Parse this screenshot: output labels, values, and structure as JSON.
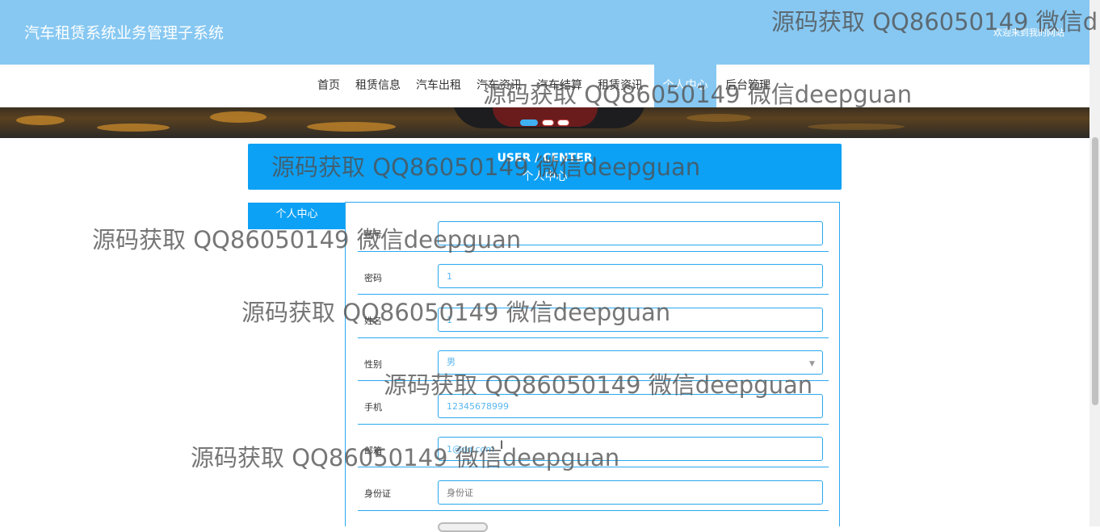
{
  "header": {
    "title": "汽车租赁系统业务管理子系统",
    "welcome": "欢迎来到我的网站"
  },
  "nav": {
    "items": [
      {
        "label": "首页"
      },
      {
        "label": "租赁信息"
      },
      {
        "label": "汽车出租"
      },
      {
        "label": "汽车资讯"
      },
      {
        "label": "汽车结算"
      },
      {
        "label": "租赁资讯"
      },
      {
        "label": "个人中心"
      },
      {
        "label": "后台管理"
      }
    ],
    "active": "个人中心"
  },
  "panel": {
    "title_en": "USER / CENTER",
    "title_cn": "个人中心"
  },
  "sidebar": {
    "items": [
      {
        "label": "个人中心"
      }
    ]
  },
  "form": {
    "username": {
      "label": "账号",
      "value": ""
    },
    "password": {
      "label": "密码",
      "value": "1"
    },
    "name": {
      "label": "姓名",
      "value": "1"
    },
    "gender": {
      "label": "性别",
      "value": "男"
    },
    "phone": {
      "label": "手机",
      "value": "12345678999"
    },
    "email": {
      "label": "邮箱",
      "value": "1@qq.com"
    },
    "idcard": {
      "label": "身份证",
      "placeholder": "身份证"
    }
  },
  "watermark": {
    "text_1": "源码获取 QQ86050149 微信d",
    "text_2": "源码获取 QQ86050149 微信deepguan",
    "text_3": "源码获取 QQ86050149 微信deepguan",
    "text_4": "源码获取 QQ86050149 微信deepguan",
    "text_5": "源码获取 QQ86050149 微信deepguan",
    "text_6": "源码获取 QQ86050149 微信deepguan",
    "text_7": "源码获取 QQ86050149 微信deepguan"
  },
  "colors": {
    "header_bg": "#87c8f2",
    "accent": "#0da1f5",
    "input_text": "#5ab7ef"
  }
}
